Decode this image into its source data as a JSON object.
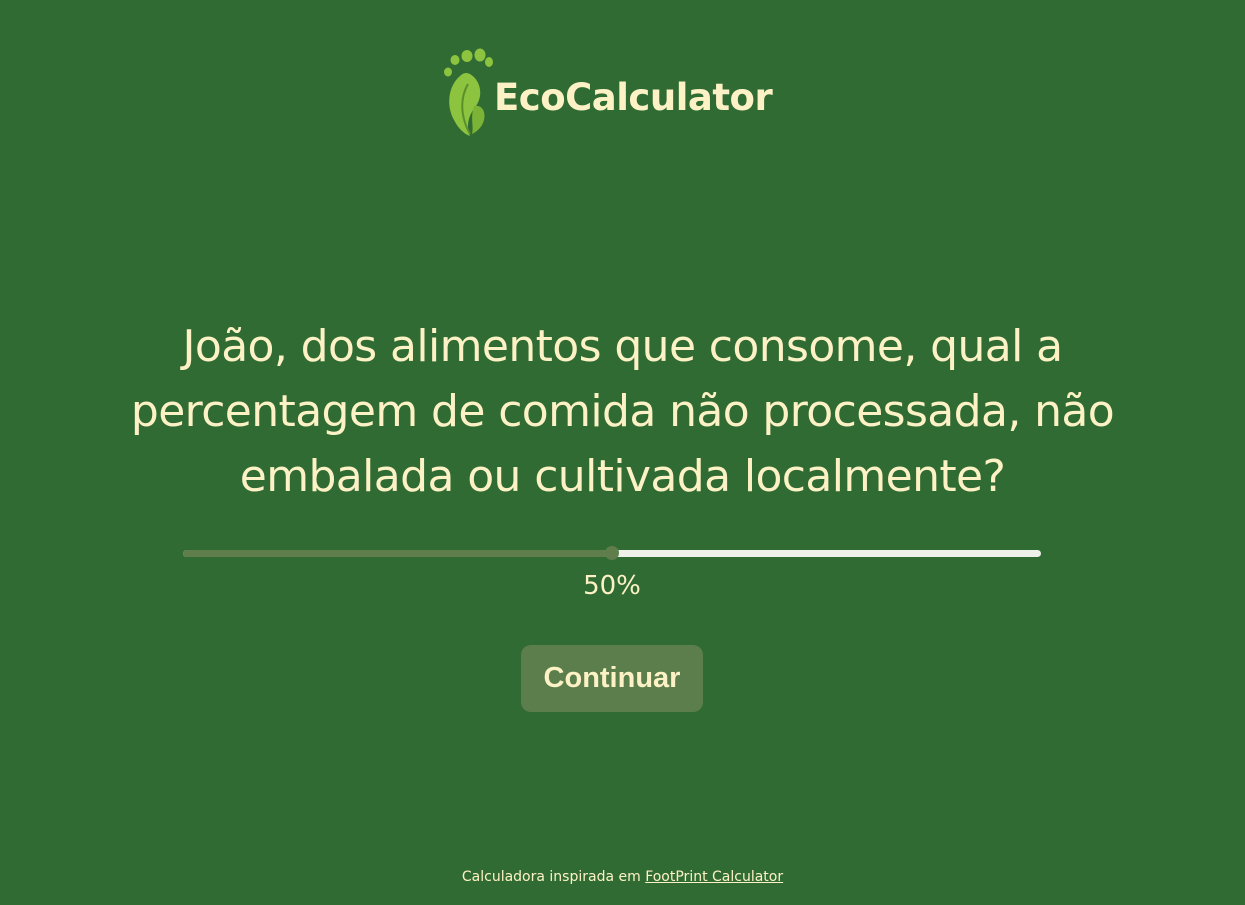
{
  "header": {
    "logo_icon": "footprint-leaf-icon",
    "brand_name": "EcoCalculator"
  },
  "question": {
    "text": "João, dos alimentos que consome, qual a percentagem de comida não processada, não embalada ou cultivada localmente?"
  },
  "slider": {
    "value_percent": 50,
    "value_label": "50%",
    "min": 0,
    "max": 100
  },
  "actions": {
    "continue_label": "Continuar"
  },
  "footer": {
    "text": "Calculadora inspirada em",
    "link_label": "FootPrint Calculator"
  },
  "colors": {
    "background": "#316b34",
    "text": "#fdf2c5",
    "accent": "#5c7e4c",
    "track": "#eef0ea",
    "logo_green": "#8cc33f"
  }
}
